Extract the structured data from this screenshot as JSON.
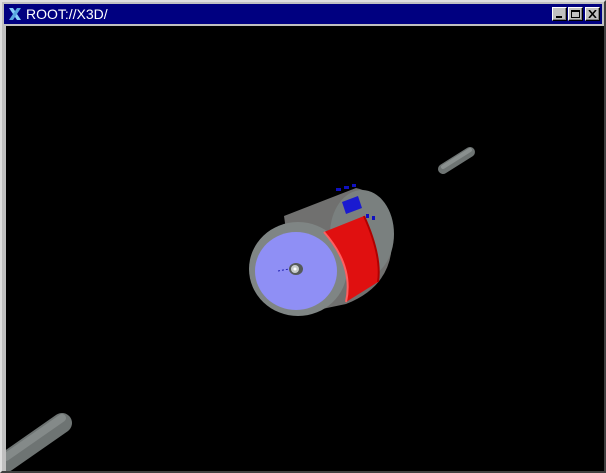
{
  "window": {
    "title": "ROOT://X3D/",
    "icon": "x-logo-icon",
    "controls": {
      "minimize": "minimize-icon",
      "maximize": "maximize-icon",
      "close": "close-icon"
    }
  },
  "viewport": {
    "background": "#000000",
    "objects": [
      "detector-cylinder",
      "red-calorimeter-segment",
      "blue-endcap",
      "beam-pipe-upper-right",
      "beam-pipe-lower-left"
    ]
  },
  "colors": {
    "titlebar": "#000080",
    "cylinder_gray": "#7f8584",
    "endcap_blue": "#8f8ff5",
    "segment_red": "#e01010",
    "stripe_blue": "#1010c0"
  }
}
